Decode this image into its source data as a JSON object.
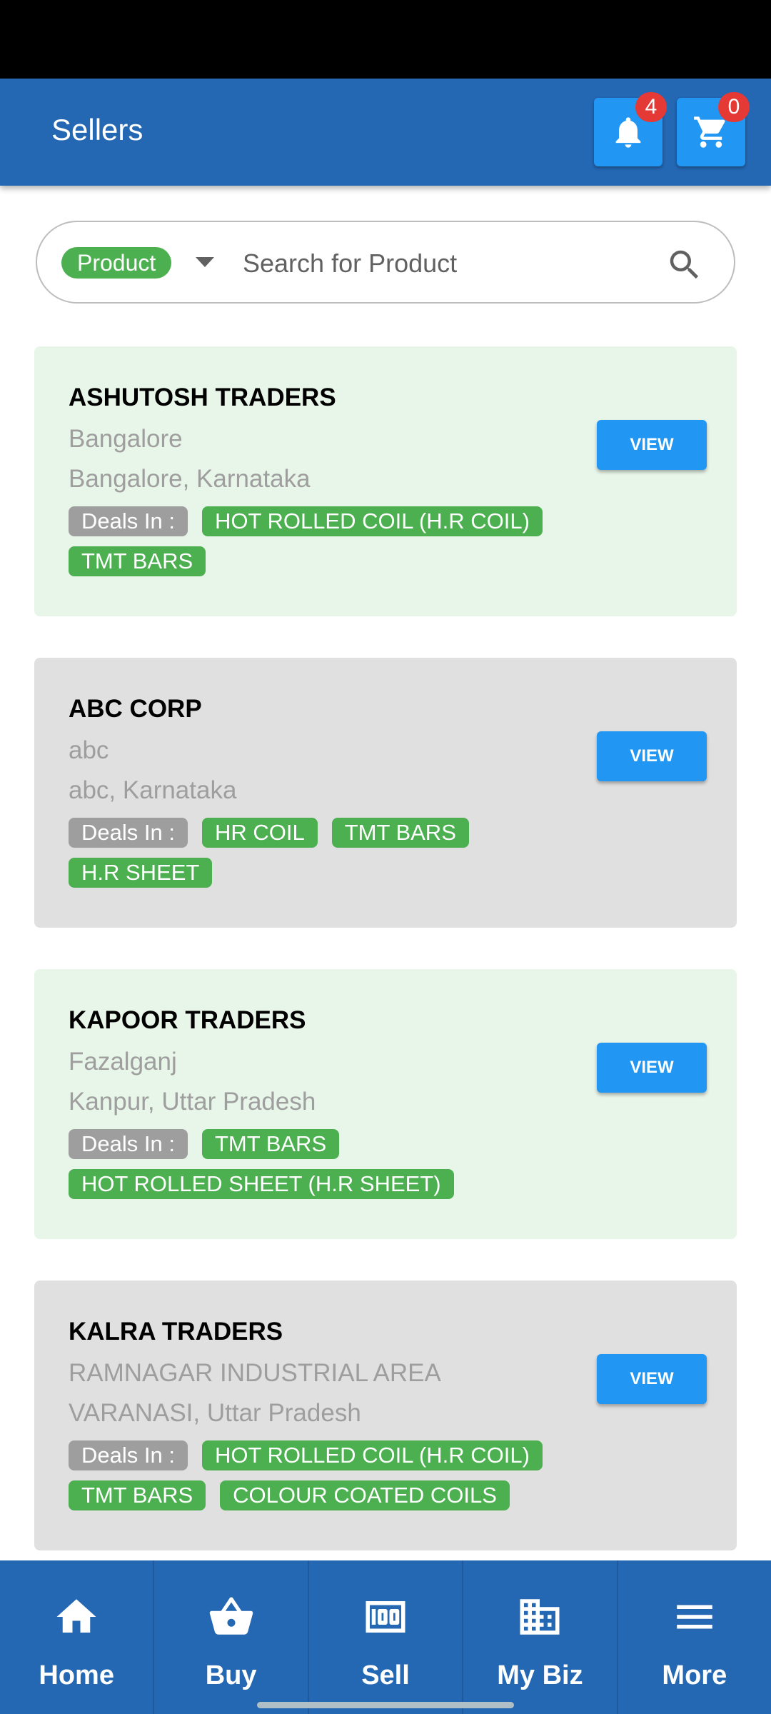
{
  "app_bar": {
    "title": "Sellers",
    "notifications_count": "4",
    "cart_count": "0",
    "notification_icon": "bell-icon",
    "cart_icon": "cart-icon"
  },
  "search": {
    "filter_label": "Product",
    "placeholder": "Search for Product",
    "value": ""
  },
  "sellers": [
    {
      "name": "ASHUTOSH TRADERS",
      "area": "Bangalore",
      "location": "Bangalore, Karnataka",
      "deals_label": "Deals In :",
      "products": [
        "HOT ROLLED COIL (H.R COIL)",
        "TMT BARS"
      ],
      "view_label": "VIEW"
    },
    {
      "name": "ABC CORP",
      "area": "abc",
      "location": "abc, Karnataka",
      "deals_label": "Deals In :",
      "products": [
        "HR COIL",
        "TMT BARS",
        "H.R SHEET"
      ],
      "view_label": "VIEW"
    },
    {
      "name": "KAPOOR TRADERS",
      "area": "Fazalganj",
      "location": "Kanpur, Uttar Pradesh",
      "deals_label": "Deals In :",
      "products": [
        "TMT BARS",
        "HOT ROLLED SHEET (H.R SHEET)"
      ],
      "view_label": "VIEW"
    },
    {
      "name": "KALRA TRADERS",
      "area": "RAMNAGAR INDUSTRIAL AREA",
      "location": "VARANASI, Uttar Pradesh",
      "deals_label": "Deals In :",
      "products": [
        "HOT ROLLED COIL (H.R COIL)",
        "TMT BARS",
        "COLOUR COATED COILS"
      ],
      "view_label": "VIEW"
    }
  ],
  "bottom_nav": [
    {
      "label": "Home",
      "icon": "home-icon"
    },
    {
      "label": "Buy",
      "icon": "basket-icon"
    },
    {
      "label": "Sell",
      "icon": "money-icon"
    },
    {
      "label": "My Biz",
      "icon": "building-icon"
    },
    {
      "label": "More",
      "icon": "menu-icon"
    }
  ],
  "colors": {
    "app_bar": "#2467b3",
    "accent_blue": "#2196f3",
    "chip_green": "#4caf50",
    "badge_red": "#e53935",
    "card_green": "#e8f5e9",
    "card_gray": "#e0e0e0"
  }
}
